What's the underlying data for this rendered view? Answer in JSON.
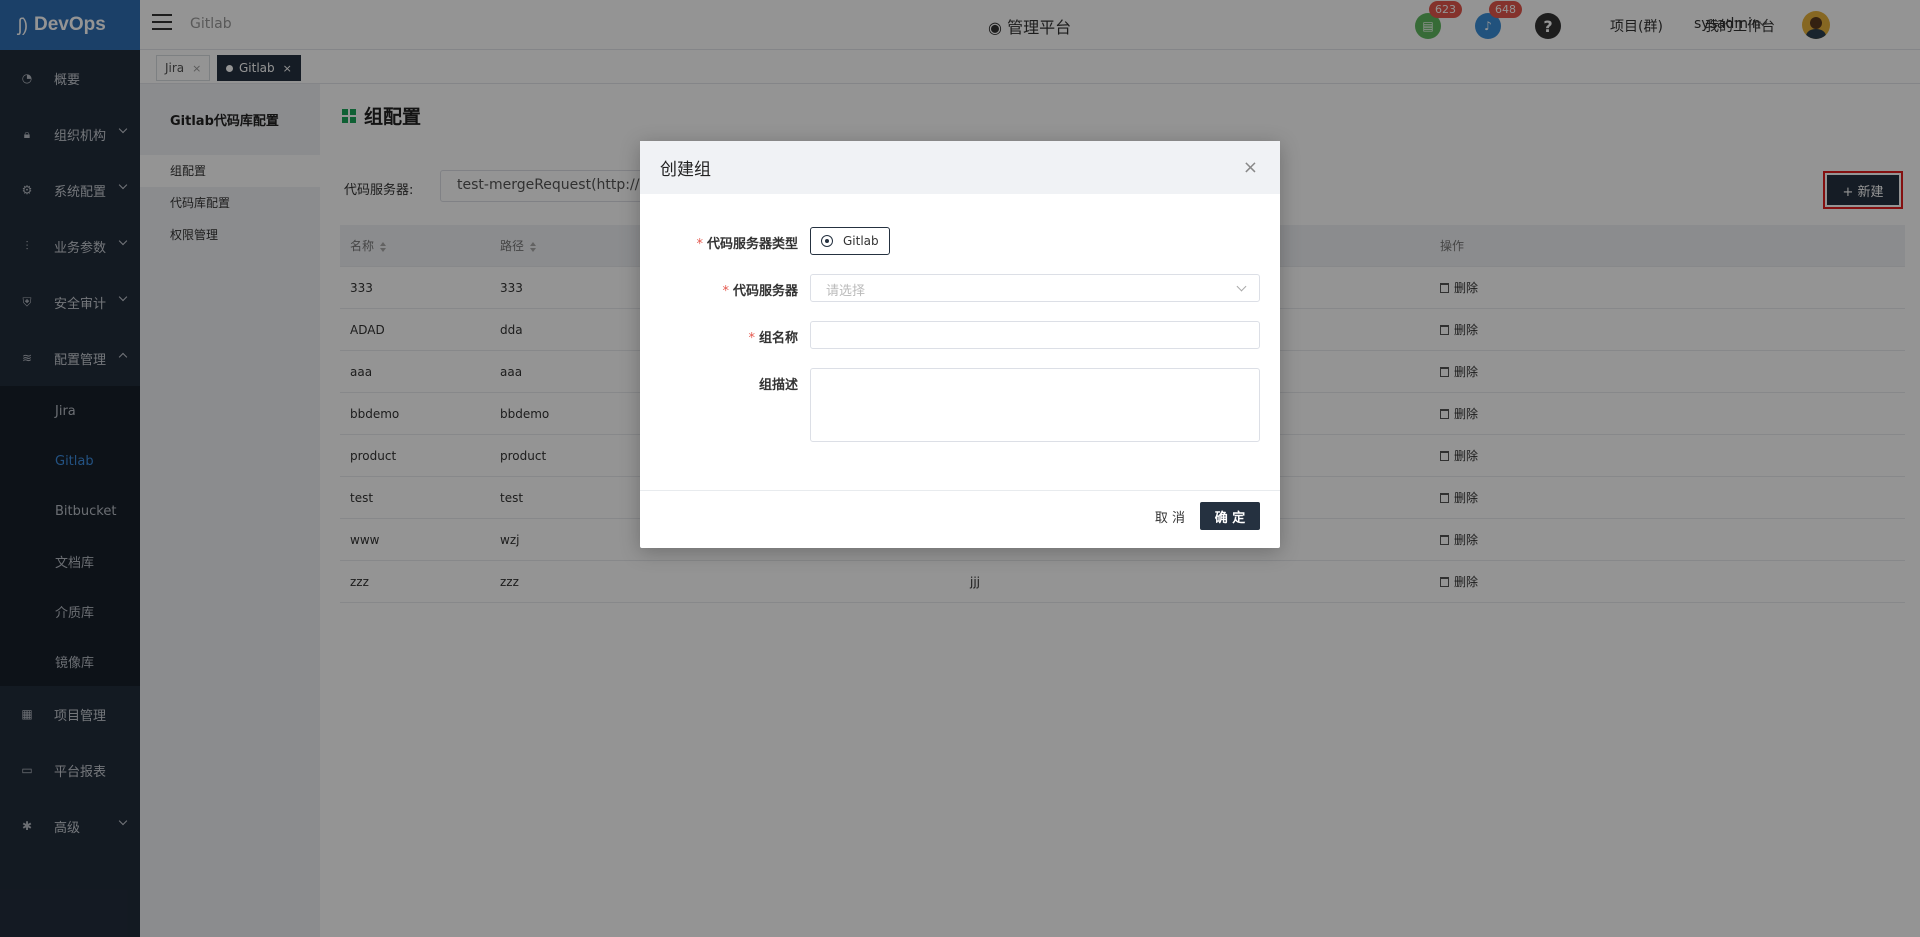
{
  "app": {
    "brand": "DevOps"
  },
  "sidebar": {
    "items": [
      {
        "label": "概要",
        "icon": "dashboard-icon"
      },
      {
        "label": "组织机构",
        "icon": "lock-icon"
      },
      {
        "label": "系统配置",
        "icon": "gear-icon"
      },
      {
        "label": "业务参数",
        "icon": "sliders-icon"
      },
      {
        "label": "安全审计",
        "icon": "shield-icon"
      },
      {
        "label": "配置管理",
        "icon": "database-icon"
      }
    ],
    "sub_items": [
      "Jira",
      "Gitlab",
      "Bitbucket",
      "文档库",
      "介质库",
      "镜像库"
    ],
    "bottom_items": [
      {
        "label": "项目管理",
        "icon": "grid-icon"
      },
      {
        "label": "平台报表",
        "icon": "monitor-icon"
      },
      {
        "label": "高级",
        "icon": "advanced-icon"
      }
    ]
  },
  "topbar": {
    "breadcrumb": "Gitlab",
    "platform": "管理平台",
    "badge_tasks": "623",
    "badge_notifications": "648",
    "help": "?",
    "project_link": "项目(群)",
    "workspace_link": "我的工作台",
    "username": "sysadmin"
  },
  "page_tabs": [
    {
      "label": "Jira"
    },
    {
      "label": "Gitlab"
    }
  ],
  "leftpanel": {
    "title": "Gitlab代码库配置",
    "items": [
      "组配置",
      "代码库配置",
      "权限管理"
    ]
  },
  "main": {
    "title": "组配置",
    "server_label": "代码服务器:",
    "server_value": "test-mergeRequest(http://1",
    "new_button": "+ 新建"
  },
  "table": {
    "headers": [
      "名称",
      "路径",
      "",
      "操作"
    ],
    "rows": [
      {
        "name": "333",
        "path": "333",
        "desc": "",
        "action": "删除"
      },
      {
        "name": "ADAD",
        "path": "dda",
        "desc": "",
        "action": "删除"
      },
      {
        "name": "aaa",
        "path": "aaa",
        "desc": "",
        "action": "删除"
      },
      {
        "name": "bbdemo",
        "path": "bbdemo",
        "desc": "",
        "action": "删除"
      },
      {
        "name": "product",
        "path": "product",
        "desc": "",
        "action": "删除"
      },
      {
        "name": "test",
        "path": "test",
        "desc": "",
        "action": "删除"
      },
      {
        "name": "www",
        "path": "wzj",
        "desc": "",
        "action": "删除"
      },
      {
        "name": "zzz",
        "path": "zzz",
        "desc": "jjj",
        "action": "删除"
      }
    ]
  },
  "modal": {
    "title": "创建组",
    "close": "×",
    "fields": {
      "server_type_label": "代码服务器类型",
      "server_type_value": "Gitlab",
      "server_label": "代码服务器",
      "server_placeholder": "请选择",
      "name_label": "组名称",
      "desc_label": "组描述"
    },
    "cancel": "取 消",
    "ok": "确 定"
  },
  "colors": {
    "sidebar_bg": "#222d3c",
    "brand_bg": "#2f6fb3",
    "primary_dark": "#253140",
    "accent_blue": "#3d8ee0",
    "badge_red": "#e4564c",
    "highlight_border": "#e31c1c"
  }
}
